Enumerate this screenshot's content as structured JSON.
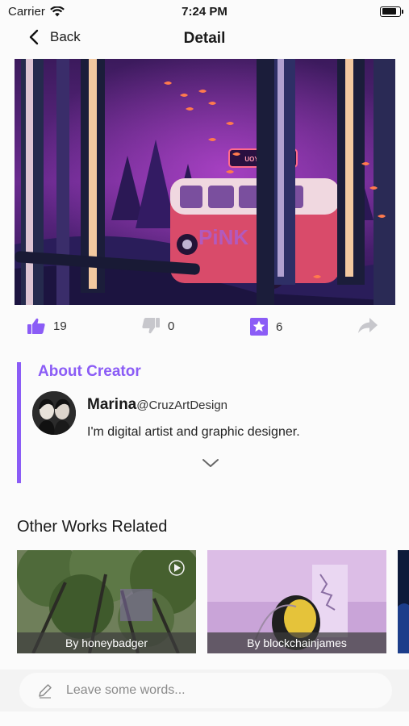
{
  "status_bar": {
    "carrier": "Carrier",
    "time": "7:24 PM",
    "battery_level": 0.85
  },
  "nav": {
    "back_label": "Back",
    "title": "Detail"
  },
  "hero": {
    "image": "van-in-purple-forest-illustration",
    "sign_text": "UOY 316 JA"
  },
  "actions": {
    "likes": "19",
    "comments": "0",
    "favorites": "6"
  },
  "about": {
    "title": "About Creator",
    "name": "Marina",
    "handle": "@CruzArtDesign",
    "bio": "I'm digital artist and graphic designer."
  },
  "other_works": {
    "title": "Other Works Related",
    "items": [
      {
        "caption": "By honeybadger"
      },
      {
        "caption": "By blockchainjames"
      }
    ]
  },
  "comment": {
    "placeholder": "Leave some words..."
  },
  "colors": {
    "accent": "#8b5cf6",
    "muted_icon": "#c7c7cc"
  }
}
